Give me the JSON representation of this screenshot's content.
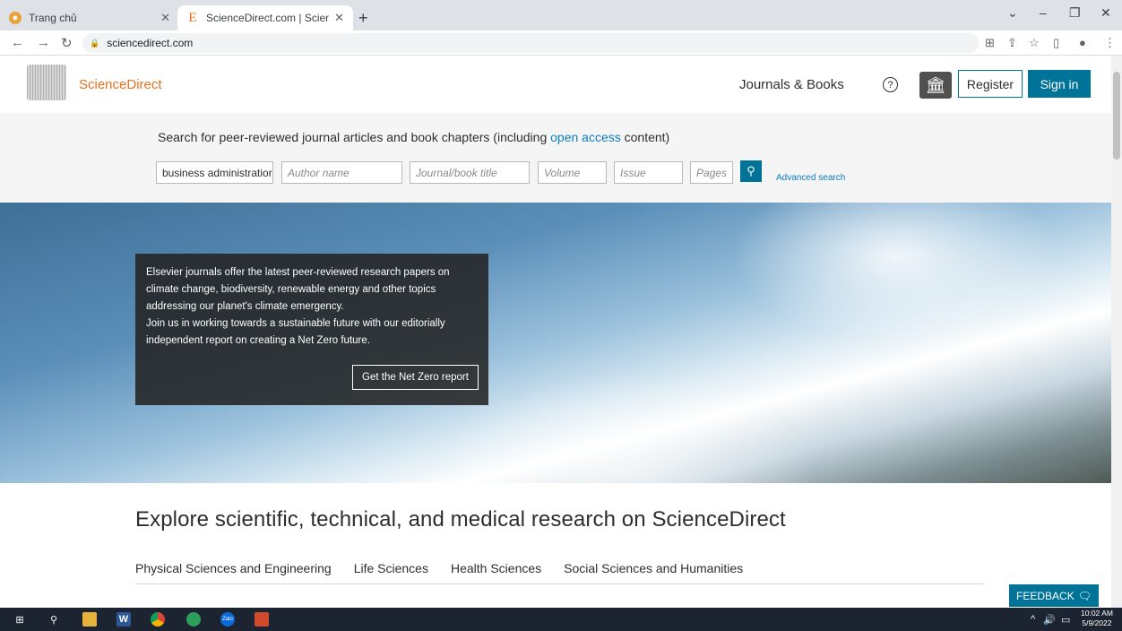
{
  "browser": {
    "tabs": [
      {
        "title": "Trang chủ",
        "active": false
      },
      {
        "title": "ScienceDirect.com | Science, heal",
        "active": true
      }
    ],
    "url": "sciencedirect.com"
  },
  "header": {
    "logo_text": "ScienceDirect",
    "journals_books": "Journals & Books",
    "help": "?",
    "register": "Register",
    "sign_in": "Sign in"
  },
  "search": {
    "intro_before": "Search for peer-reviewed journal articles and book chapters (including ",
    "intro_link": "open access",
    "intro_after": " content)",
    "keywords_value": "business administratior",
    "author_placeholder": "Author name",
    "journal_placeholder": "Journal/book title",
    "volume_placeholder": "Volume",
    "issue_placeholder": "Issue",
    "pages_placeholder": "Pages",
    "advanced": "Advanced search"
  },
  "hero": {
    "lines": [
      "Elsevier journals offer the latest peer-reviewed research papers on",
      "climate change, biodiversity, renewable energy and other topics",
      "addressing our planet's climate emergency.",
      "Join us in working towards a sustainable future with our editorially",
      "independent report on creating a Net Zero future."
    ],
    "button": "Get the Net Zero report"
  },
  "explore": {
    "title": "Explore scientific, technical, and medical research on ScienceDirect",
    "categories": [
      "Physical Sciences and Engineering",
      "Life Sciences",
      "Health Sciences",
      "Social Sciences and Humanities"
    ]
  },
  "feedback": "FEEDBACK",
  "taskbar": {
    "time": "10:02 AM",
    "date": "5/9/2022"
  },
  "colors": {
    "primary": "#007398",
    "brand_orange": "#e9711c",
    "link": "#0c7dbb"
  }
}
